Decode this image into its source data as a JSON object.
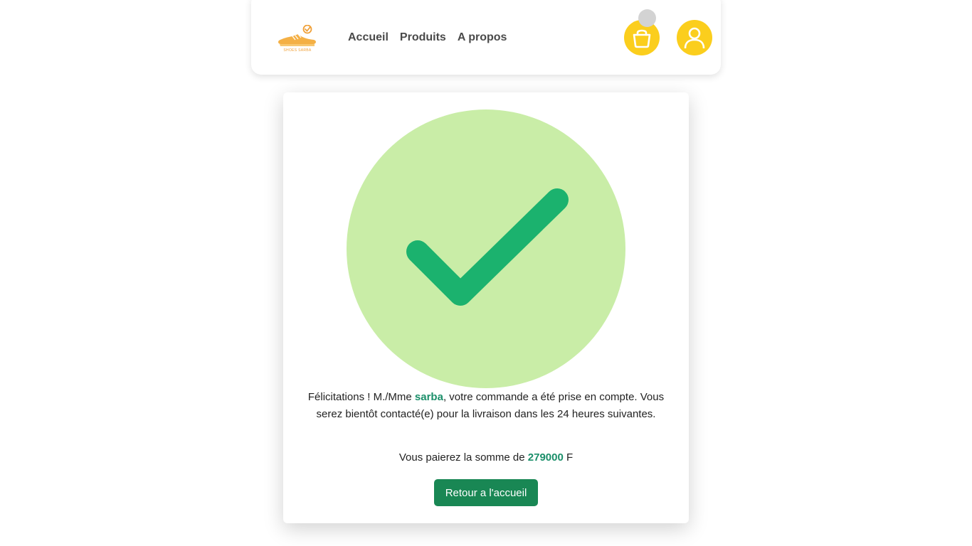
{
  "brand": {
    "logo_text": "SHOES SARBA"
  },
  "nav": {
    "links": [
      "Accueil",
      "Produits",
      "A propos"
    ]
  },
  "confirmation": {
    "prefix": "Félicitations ! M./Mme ",
    "customer_name": "sarba",
    "suffix": ", votre commande a été prise en compte. Vous serez bientôt contacté(e) pour la livraison dans les 24 heures suivantes.",
    "amount_prefix": "Vous paierez la somme de ",
    "amount": "279000",
    "currency": " F",
    "button_label": "Retour a l'accueil"
  },
  "colors": {
    "accent_yellow": "#fbce1d",
    "check_bg": "#c9eda7",
    "check_mark": "#1bb26e",
    "button_green": "#198754"
  },
  "icons": {
    "cart": "shopping-bag-icon",
    "user": "user-icon",
    "check": "check-icon"
  }
}
